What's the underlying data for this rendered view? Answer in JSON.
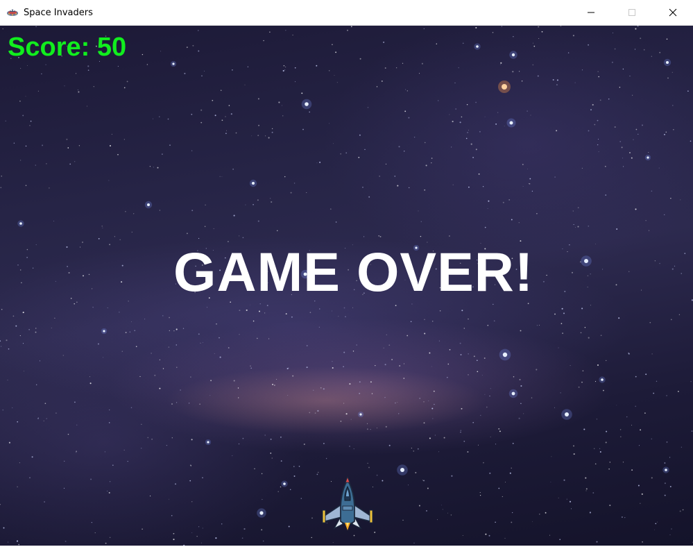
{
  "window": {
    "title": "Space Invaders",
    "app_icon": "alien-invader-icon",
    "controls": [
      "minimize-icon",
      "maximize-icon",
      "close-icon"
    ]
  },
  "game": {
    "score_text": "Score: 50",
    "score": 50,
    "message": "GAME OVER!",
    "player": "spaceship-icon",
    "background": "starfield-milky-way",
    "colors": {
      "score": "#11ee1e",
      "message": "#ffffff"
    }
  }
}
